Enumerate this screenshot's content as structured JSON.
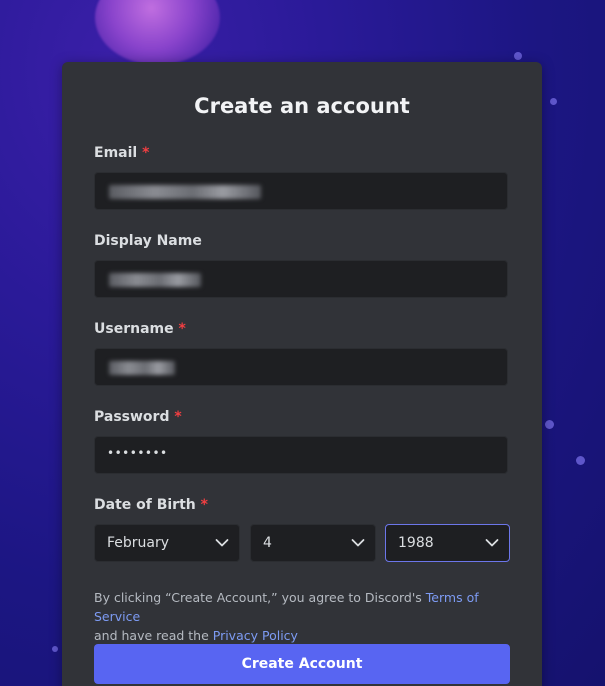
{
  "form": {
    "title": "Create an account",
    "email": {
      "label": "Email",
      "required_marker": "*"
    },
    "display_name": {
      "label": "Display Name"
    },
    "username": {
      "label": "Username",
      "required_marker": "*"
    },
    "password": {
      "label": "Password",
      "required_marker": "*",
      "masked_value": "••••••••"
    },
    "date_of_birth": {
      "label": "Date of Birth",
      "required_marker": "*",
      "month": "February",
      "day": "4",
      "year": "1988"
    },
    "legal": {
      "prefix": "By clicking “Create Account,” you agree to Discord's ",
      "terms_link": "Terms of Service",
      "middle": "and have read the ",
      "privacy_link": "Privacy Policy"
    },
    "submit_label": "Create Account"
  },
  "colors": {
    "accent": "#5865f2",
    "card_bg": "#313338",
    "input_bg": "#1e1f22",
    "link": "#7d9bf3",
    "required": "#f23f42"
  },
  "icons": {
    "select_chevron": "chevron-down-icon"
  }
}
